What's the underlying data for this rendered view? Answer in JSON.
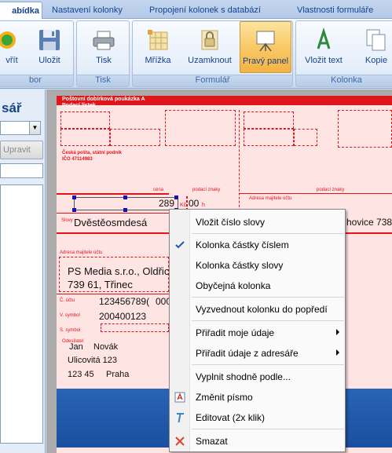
{
  "tabs": [
    "abídka",
    "Nastavení kolonky",
    "Propojení kolonek s databází",
    "Vlastnosti formuláře"
  ],
  "ribbon": {
    "groups": [
      {
        "label": "bor",
        "buttons": [
          "vřít",
          "Uložit"
        ]
      },
      {
        "label": "Tisk",
        "buttons": [
          "Tisk"
        ]
      },
      {
        "label": "Formulář",
        "buttons": [
          "Mřížka",
          "Uzamknout",
          "Pravý panel"
        ]
      },
      {
        "label": "Kolonka",
        "buttons": [
          "Vložit text",
          "Kopie"
        ]
      }
    ]
  },
  "left_pane": {
    "title": "sář",
    "edit_button": "Upravit"
  },
  "document": {
    "header_line1": "Poštovní dobírková poukázka A",
    "header_line2": "Podací lístek",
    "post_name": "Česká pošta, státní podnik",
    "ico": "IČO 47114983",
    "cena_label": "cena",
    "podaci_znaky": "podací znaky",
    "amount": "289",
    "kc": "Kč",
    "halere": "00",
    "h": "h",
    "slovy_label": "Slovy",
    "amount_words": "Dvěstěosmdesá",
    "adresa_label": "Adresa majitele účtu",
    "adresa_label2": "Adresa majitele účtu",
    "company": "PS Media s.r.o., Oldřich",
    "city": "739 61, Třinec",
    "right_city": "hovice 738",
    "cislo_uctu_label": "Č. účtu",
    "account": "123456789(",
    "account_tail": "000",
    "vsymbol_label": "V. symbol",
    "vsymbol": "200400123",
    "ssymbol_label": "S. symbol",
    "odesilatel_label": "Odesílatel",
    "first_name": "Jan",
    "last_name": "Novák",
    "street": "Ulicovitá 123",
    "zip": "123 45",
    "town": "Praha"
  },
  "context_menu": {
    "items": [
      {
        "label": "Vložit číslo slovy",
        "icon": "",
        "submenu": false
      },
      {
        "label": "Kolonka částky číslem",
        "icon": "check-icon",
        "submenu": false
      },
      {
        "label": "Kolonka částky slovy",
        "icon": "",
        "submenu": false
      },
      {
        "label": "Obyčejná kolonka",
        "icon": "",
        "submenu": false
      },
      {
        "label": "Vyzvednout kolonku do popředí",
        "icon": "",
        "submenu": false
      },
      {
        "label": "Přiřadit moje údaje",
        "icon": "",
        "submenu": true
      },
      {
        "label": "Přiřadit údaje z adresáře",
        "icon": "",
        "submenu": true
      },
      {
        "label": "Vyplnit shodně podle...",
        "icon": "",
        "submenu": false
      },
      {
        "label": "Změnit písmo",
        "icon": "font-icon",
        "submenu": false
      },
      {
        "label": "Editovat (2x klik)",
        "icon": "edit-text-icon",
        "submenu": false
      },
      {
        "label": "Smazat",
        "icon": "delete-icon",
        "submenu": false
      }
    ]
  },
  "colors": {
    "accent": "#e0161d",
    "ribbon": "#dbe7f5",
    "selected_button": "#f9c966"
  }
}
